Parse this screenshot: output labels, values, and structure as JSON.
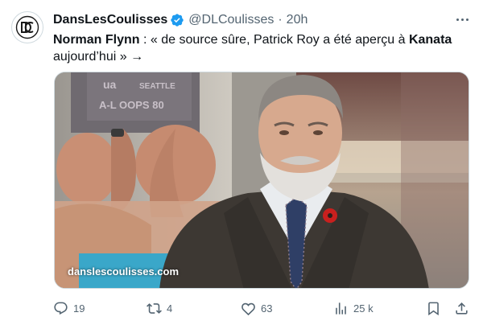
{
  "tweet": {
    "author": {
      "display_name": "DansLesCoulisses",
      "handle": "@DLCoulisses",
      "separator": "·",
      "time": "20h",
      "avatar_icon": "dlc-logo-icon",
      "verified_icon": "verified-badge-icon",
      "verified_color": "#1d9bf0"
    },
    "text": {
      "part1_bold": "Norman Flynn",
      "part2": " : « de source sûre, Patrick Roy a été aperçu à ",
      "part3_bold": "Kanata",
      "part4": " aujourd’hui » →"
    },
    "media": {
      "watermark": "danslescoulisses.com"
    },
    "metrics": {
      "replies": "19",
      "retweets": "4",
      "likes": "63",
      "views": "25 k"
    },
    "colors": {
      "text_primary": "#0f1419",
      "text_secondary": "#536471",
      "boutonniere": "#c8201e"
    }
  }
}
